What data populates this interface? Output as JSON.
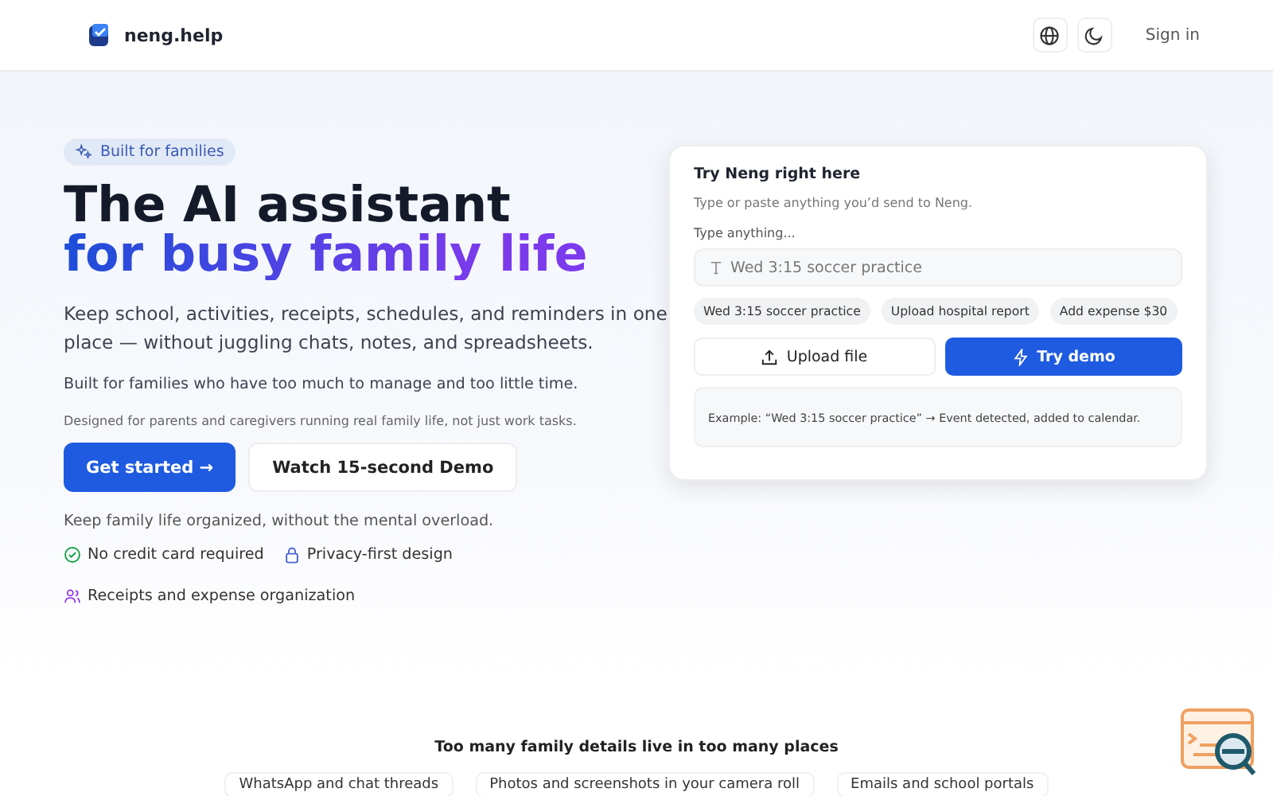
{
  "header": {
    "brand": "neng.help",
    "sign_in": "Sign in"
  },
  "hero": {
    "badge": "Built for families",
    "title_line1": "The AI assistant",
    "title_line2": "for busy family life",
    "lead": "Keep school, activities, receipts, schedules, and reminders in one place — without juggling chats, notes, and spreadsheets.",
    "subtext": "Built for families who have too much to manage and too little time.",
    "note": "Designed for parents and caregivers running real family life, not just work tasks.",
    "primary_button": "Get started",
    "primary_arrow": "→",
    "secondary_button": "Watch 15-second Demo",
    "tagline": "Keep family life organized, without the mental overload.",
    "features": [
      {
        "kind": "check",
        "label": "No credit card required"
      },
      {
        "kind": "lock",
        "label": "Privacy-first design"
      },
      {
        "kind": "people",
        "label": "Receipts and expense organization"
      }
    ]
  },
  "demo": {
    "title": "Try Neng right here",
    "subtitle": "Type or paste anything you’d send to Neng.",
    "input_label": "Type anything...",
    "placeholder": "Wed 3:15 soccer practice",
    "suggestions": [
      "Wed 3:15 soccer practice",
      "Upload hospital report",
      "Add expense $30"
    ],
    "upload_button": "Upload file",
    "try_button": "Try demo",
    "example": "Example: “Wed 3:15 soccer practice” → Event detected, added to calendar."
  },
  "section": {
    "title": "Too many family details live in too many places",
    "chips": [
      "WhatsApp and chat threads",
      "Photos and screenshots in your camera roll",
      "Emails and school portals"
    ]
  }
}
